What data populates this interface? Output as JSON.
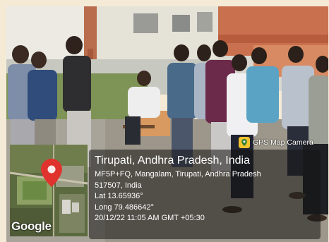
{
  "badge": {
    "icon": "gps-map-camera-icon",
    "text": "GPS Map Camera"
  },
  "map": {
    "watermark": "Google",
    "pin_icon": "location-pin-icon"
  },
  "location": {
    "title": "Tirupati, Andhra Pradesh, India",
    "address_line1": "MF5P+FQ, Mangalam, Tirupati, Andhra Pradesh",
    "address_line2": "517507, India",
    "latitude": "Lat 13.65936°",
    "longitude": "Long 79.486642°",
    "timestamp": "20/12/22 11:05 AM GMT +05:30"
  },
  "colors": {
    "frame": "#f4ead6",
    "pin": "#e0332e",
    "info_overlay": "#141414"
  }
}
